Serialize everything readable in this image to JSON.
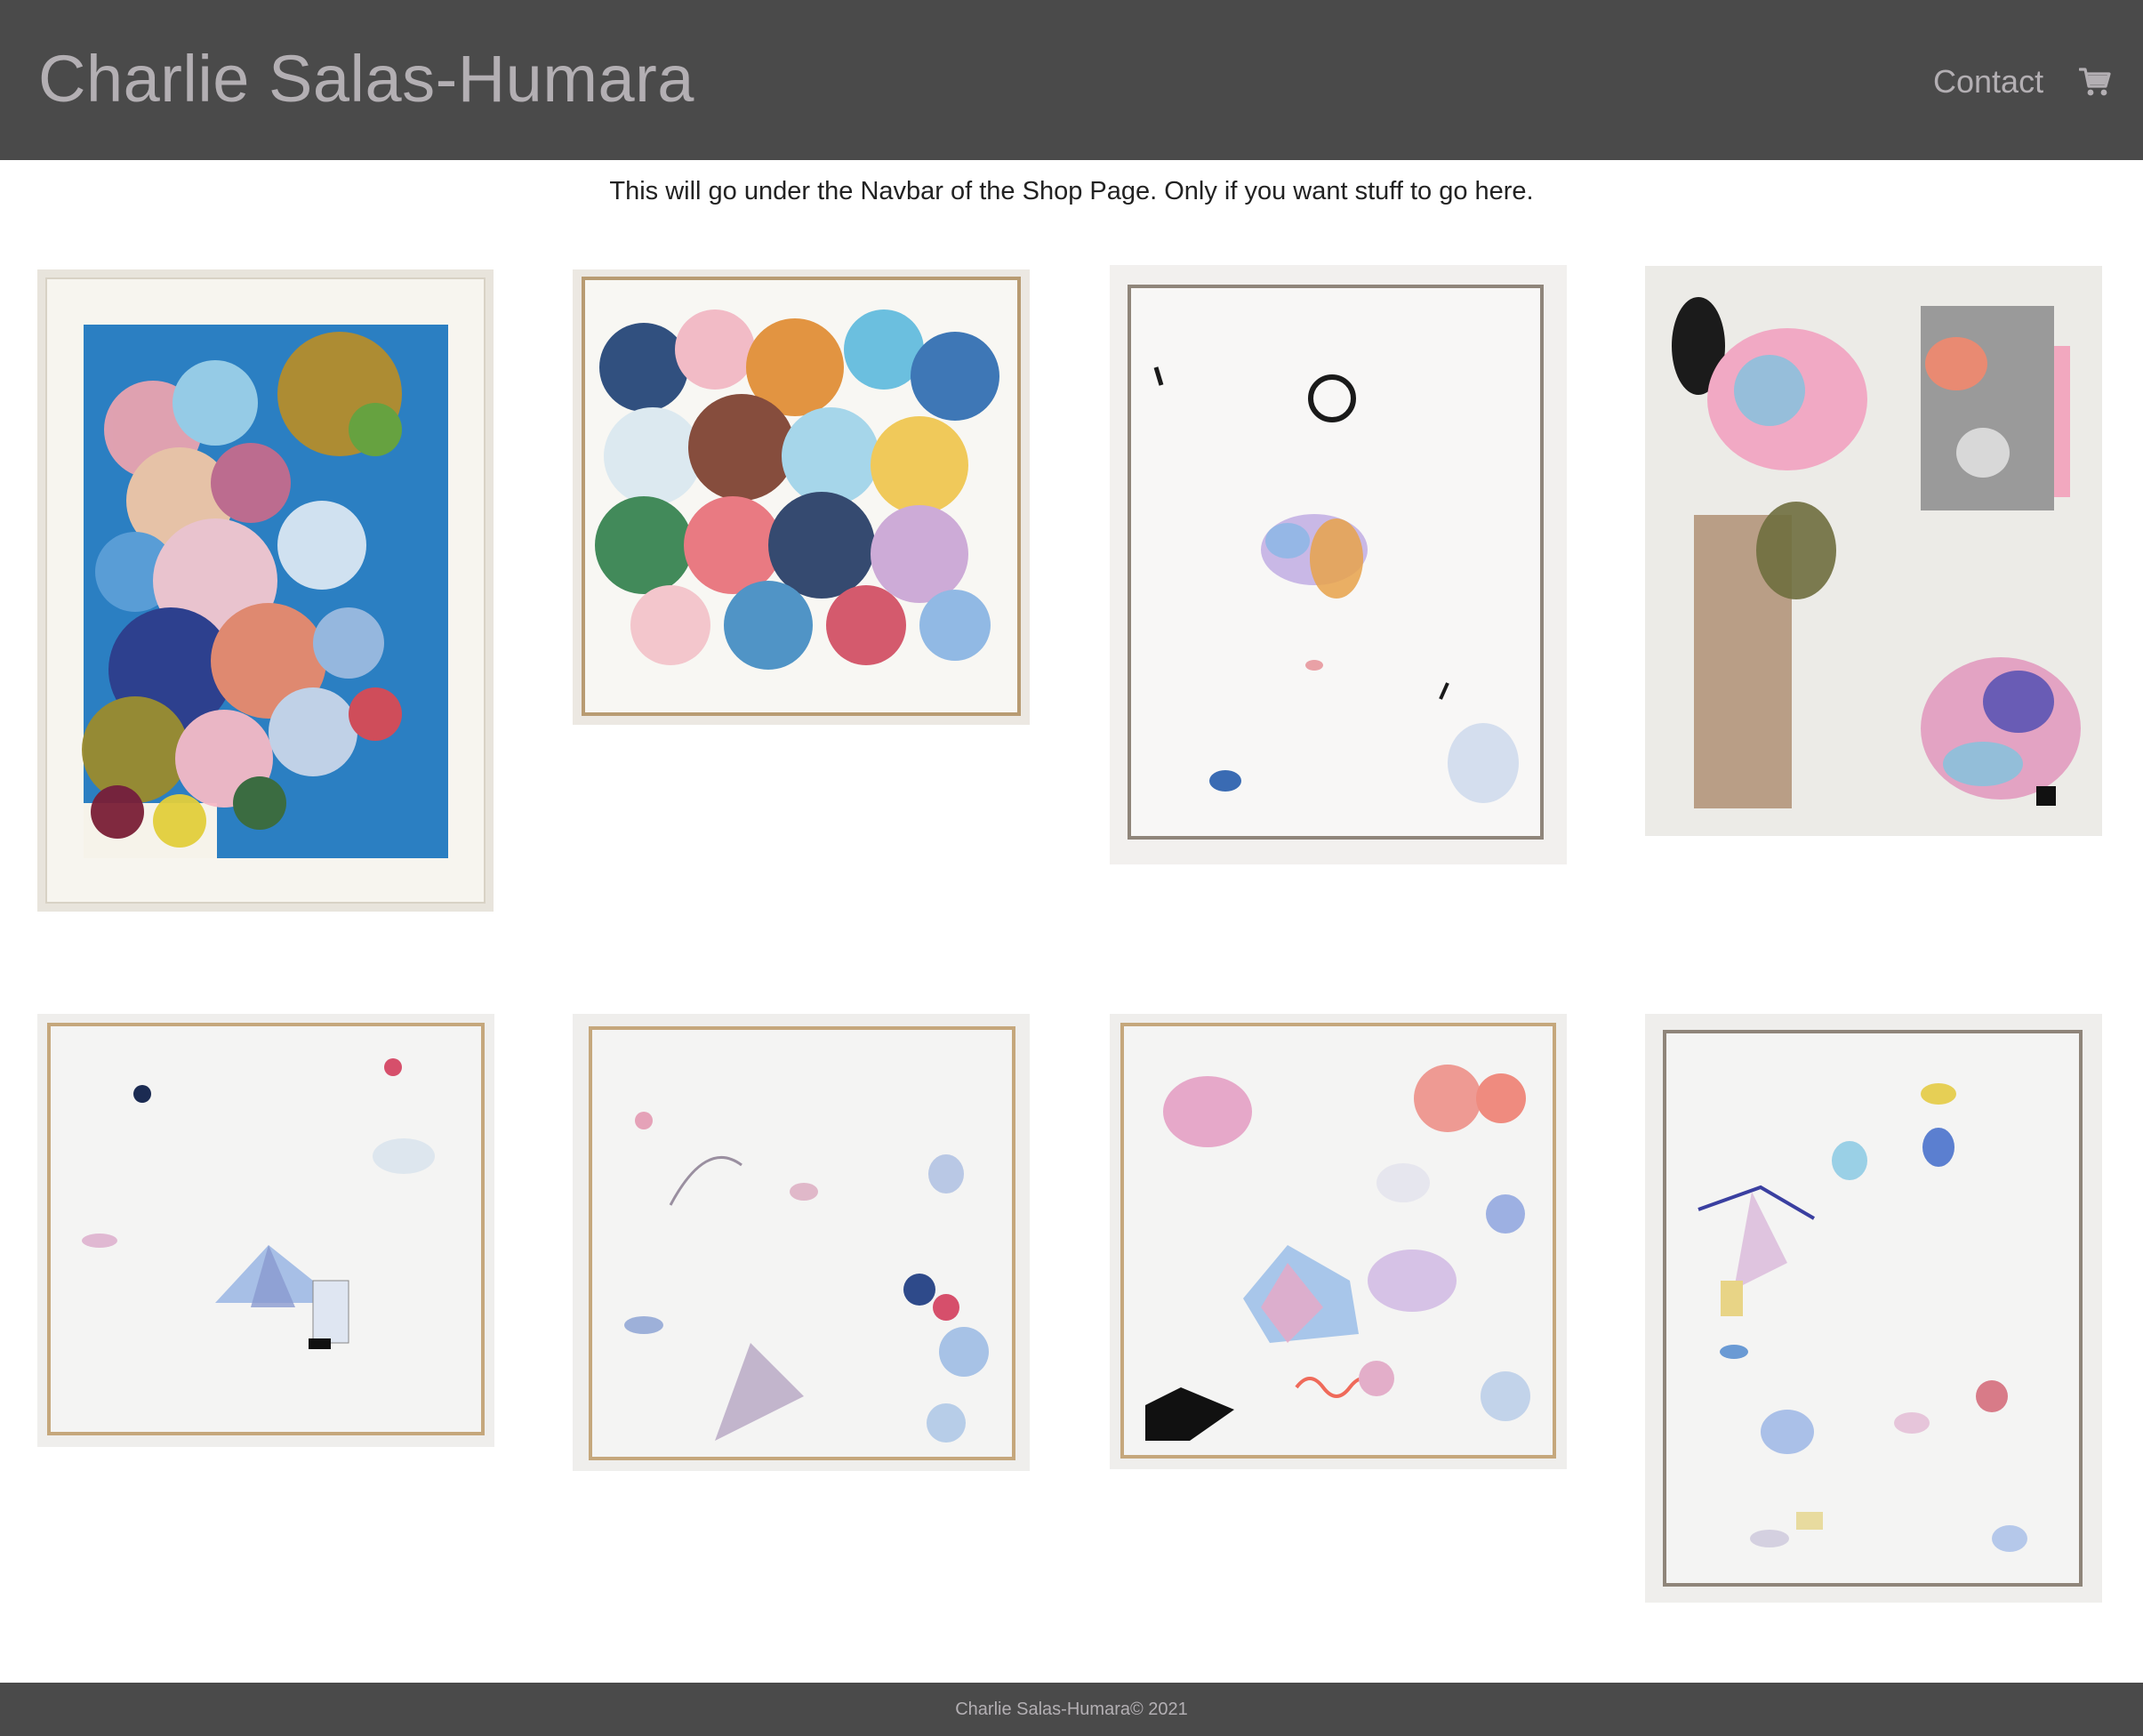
{
  "brand": {
    "title": "Charlie Salas-Humara"
  },
  "nav": {
    "contact_label": "Contact",
    "cart_icon": "shopping-cart-icon"
  },
  "intro": {
    "text": "This will go under the Navbar of the Shop Page. Only if you want stuff to go here."
  },
  "gallery": {
    "items": [
      {
        "kind": "blue-field-painting"
      },
      {
        "kind": "dense-swirl-painting"
      },
      {
        "kind": "sparse-white-painting"
      },
      {
        "kind": "collage"
      },
      {
        "kind": "white-tent-painting"
      },
      {
        "kind": "white-scribble-painting"
      },
      {
        "kind": "pink-blue-painting"
      },
      {
        "kind": "tall-white-painting"
      }
    ]
  },
  "footer": {
    "text": "Charlie Salas-Humara© 2021"
  },
  "colors": {
    "navbar_bg": "#4a4a4a",
    "nav_text": "#b3afb3",
    "body_text": "#222222",
    "page_bg": "#ffffff"
  }
}
